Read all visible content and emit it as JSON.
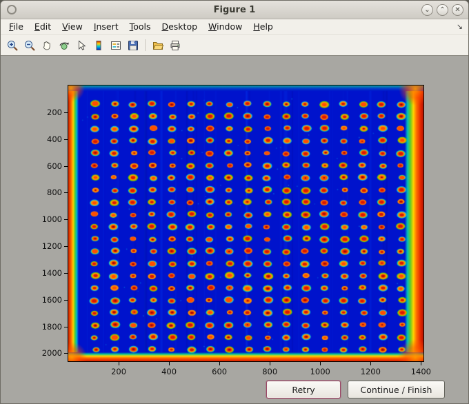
{
  "window": {
    "title": "Figure 1",
    "controls": {
      "shade": "⌄",
      "maximize": "⌃",
      "close": "✕"
    }
  },
  "menu_bar": {
    "items": [
      {
        "label": "File",
        "accel": "F",
        "rest": "ile"
      },
      {
        "label": "Edit",
        "accel": "E",
        "rest": "dit"
      },
      {
        "label": "View",
        "accel": "V",
        "rest": "iew"
      },
      {
        "label": "Insert",
        "accel": "I",
        "rest": "nsert"
      },
      {
        "label": "Tools",
        "accel": "T",
        "rest": "ools"
      },
      {
        "label": "Desktop",
        "accel": "D",
        "rest": "esktop"
      },
      {
        "label": "Window",
        "accel": "W",
        "rest": "indow"
      },
      {
        "label": "Help",
        "accel": "H",
        "rest": "elp"
      }
    ],
    "dock_icon": "↘"
  },
  "toolbar": {
    "icons": [
      "zoom-in",
      "zoom-out",
      "pan",
      "rotate-3d",
      "data-cursor",
      "colorbar",
      "legend",
      "save",
      "open",
      "print"
    ]
  },
  "buttons": {
    "retry": "Retry",
    "continue": "Continue / Finish"
  },
  "chart_data": {
    "type": "heatmap",
    "title": "",
    "xlabel": "",
    "ylabel": "",
    "colormap": "jet",
    "description": "imagesc-style scan of a microplate/microarray: deep blue field with a regular grid of red/orange spots (green-cyan halos), strongly saturated red/orange vignetting along left, right and bottom edges",
    "x_range": [
      0,
      1410
    ],
    "y_range": [
      0,
      2060
    ],
    "x_ticks": [
      200,
      400,
      600,
      800,
      1000,
      1200,
      1400
    ],
    "y_ticks": [
      200,
      400,
      600,
      800,
      1000,
      1200,
      1400,
      1600,
      1800,
      2000
    ],
    "grid": false,
    "spots": {
      "cols": 17,
      "rows": 21
    },
    "colors": {
      "field": "#0013cc",
      "spot_core": "#d81800",
      "spot_ring": "#ff9000",
      "spot_halo": "#00e0a8",
      "edge_hot": "#e22500",
      "edge_warm": "#ffd400"
    }
  }
}
